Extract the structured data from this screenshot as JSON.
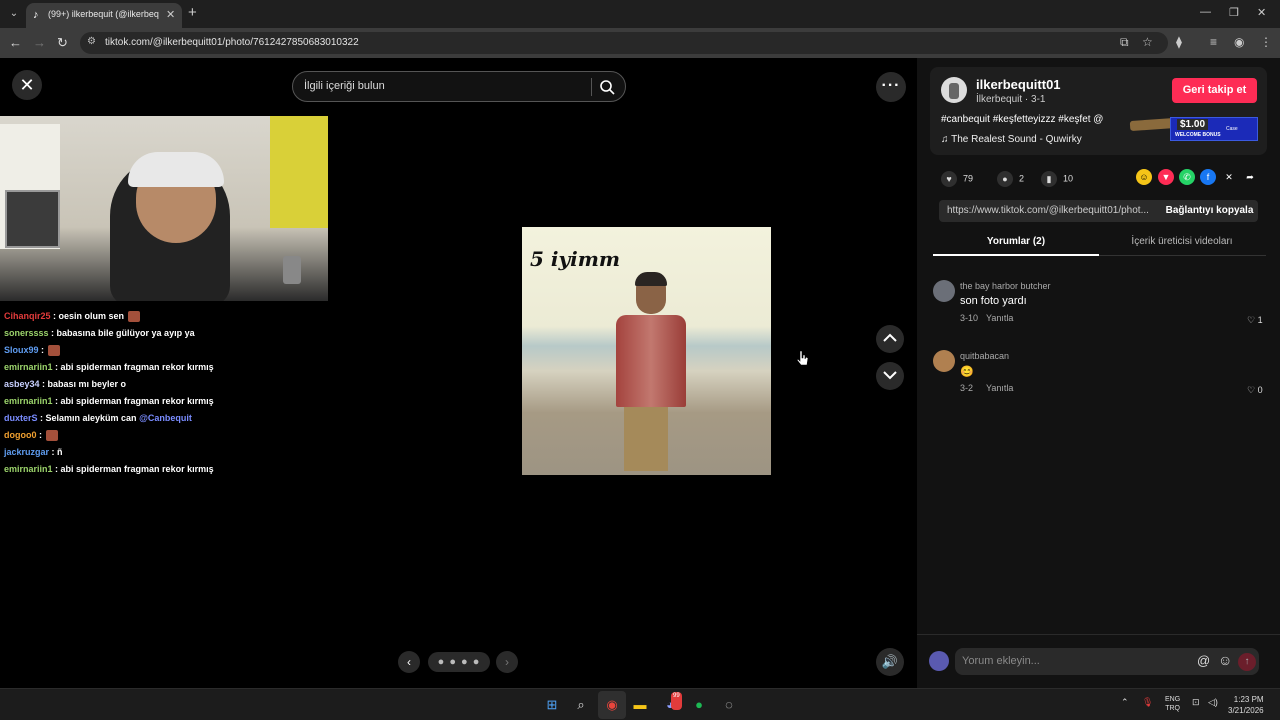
{
  "browser": {
    "tab_title": "(99+) ilkerbequit (@ilkerbeq",
    "url": "tiktok.com/@ilkerbequitt01/photo/7612427850683010322"
  },
  "viewer": {
    "search_placeholder": "İlgili içeriği bulun",
    "pager_dots": "● ● ● ●"
  },
  "chat": [
    {
      "user": "Cihanqir25",
      "color": "#e23b3b",
      "text": " : oesin olum sen",
      "emote": true
    },
    {
      "user": "sonerssss",
      "color": "#9bd36b",
      "text": " : babasına bile gülüyor ya ayıp ya"
    },
    {
      "user": "Sloux99",
      "color": "#5f9cf0",
      "text": " :",
      "emote": true
    },
    {
      "user": "emirnariin1",
      "color": "#9bd36b",
      "text": " : abi spiderman fragman rekor kırmış"
    },
    {
      "user": "asbey34",
      "color": "#c8d0ff",
      "text": " : babası mı beyler o"
    },
    {
      "user": "emirnariin1",
      "color": "#9bd36b",
      "text": " : abi spiderman fragman rekor kırmış"
    },
    {
      "user": "duxterS",
      "color": "#7a8cff",
      "text": " : Selamın aleyküm can ",
      "mention": "@Canbequit"
    },
    {
      "user": "dogoo0",
      "color": "#f0a030",
      "text": " :",
      "emote": true
    },
    {
      "user": "jackruzgar",
      "color": "#5f9cf0",
      "text": " : ñ"
    },
    {
      "user": "emirnariin1",
      "color": "#9bd36b",
      "text": " : abi spiderman fragman rekor kırmış"
    }
  ],
  "photo": {
    "caption": "5 iyimm"
  },
  "post": {
    "username": "ilkerbequitt01",
    "subline": "İlkerbequit · 3-1",
    "follow_label": "Geri takip et",
    "tags": "#canbequit #keşfetteyizzz #keşfet @",
    "sound": "♫  The Realest Sound - Quwirky",
    "ad_amount": "$1.00",
    "ad_bonus": "WELCOME BONUS",
    "ad_brand": "Case"
  },
  "stats": {
    "likes": "79",
    "comments": "2",
    "saves": "10"
  },
  "link": {
    "url": "https://www.tiktok.com/@ilkerbequitt01/phot...",
    "copy_label": "Bağlantıyı kopyala"
  },
  "tabs": {
    "comments": "Yorumlar (2)",
    "creator_videos": "İçerik üreticisi videoları"
  },
  "comments": [
    {
      "name": "the bay harbor butcher",
      "text": "son foto yardı",
      "date": "3-10",
      "reply": "Yanıtla",
      "likes": "1"
    },
    {
      "name": "quitbabacan",
      "text": "😊",
      "date": "3-2",
      "reply": "Yanıtla",
      "likes": "0"
    }
  ],
  "composer": {
    "placeholder": "Yorum ekleyin..."
  },
  "taskbar": {
    "lang_top": "ENG",
    "lang_bottom": "TRQ",
    "time": "1:23 PM",
    "date": "3/21/2026",
    "discord_badge": "99"
  }
}
